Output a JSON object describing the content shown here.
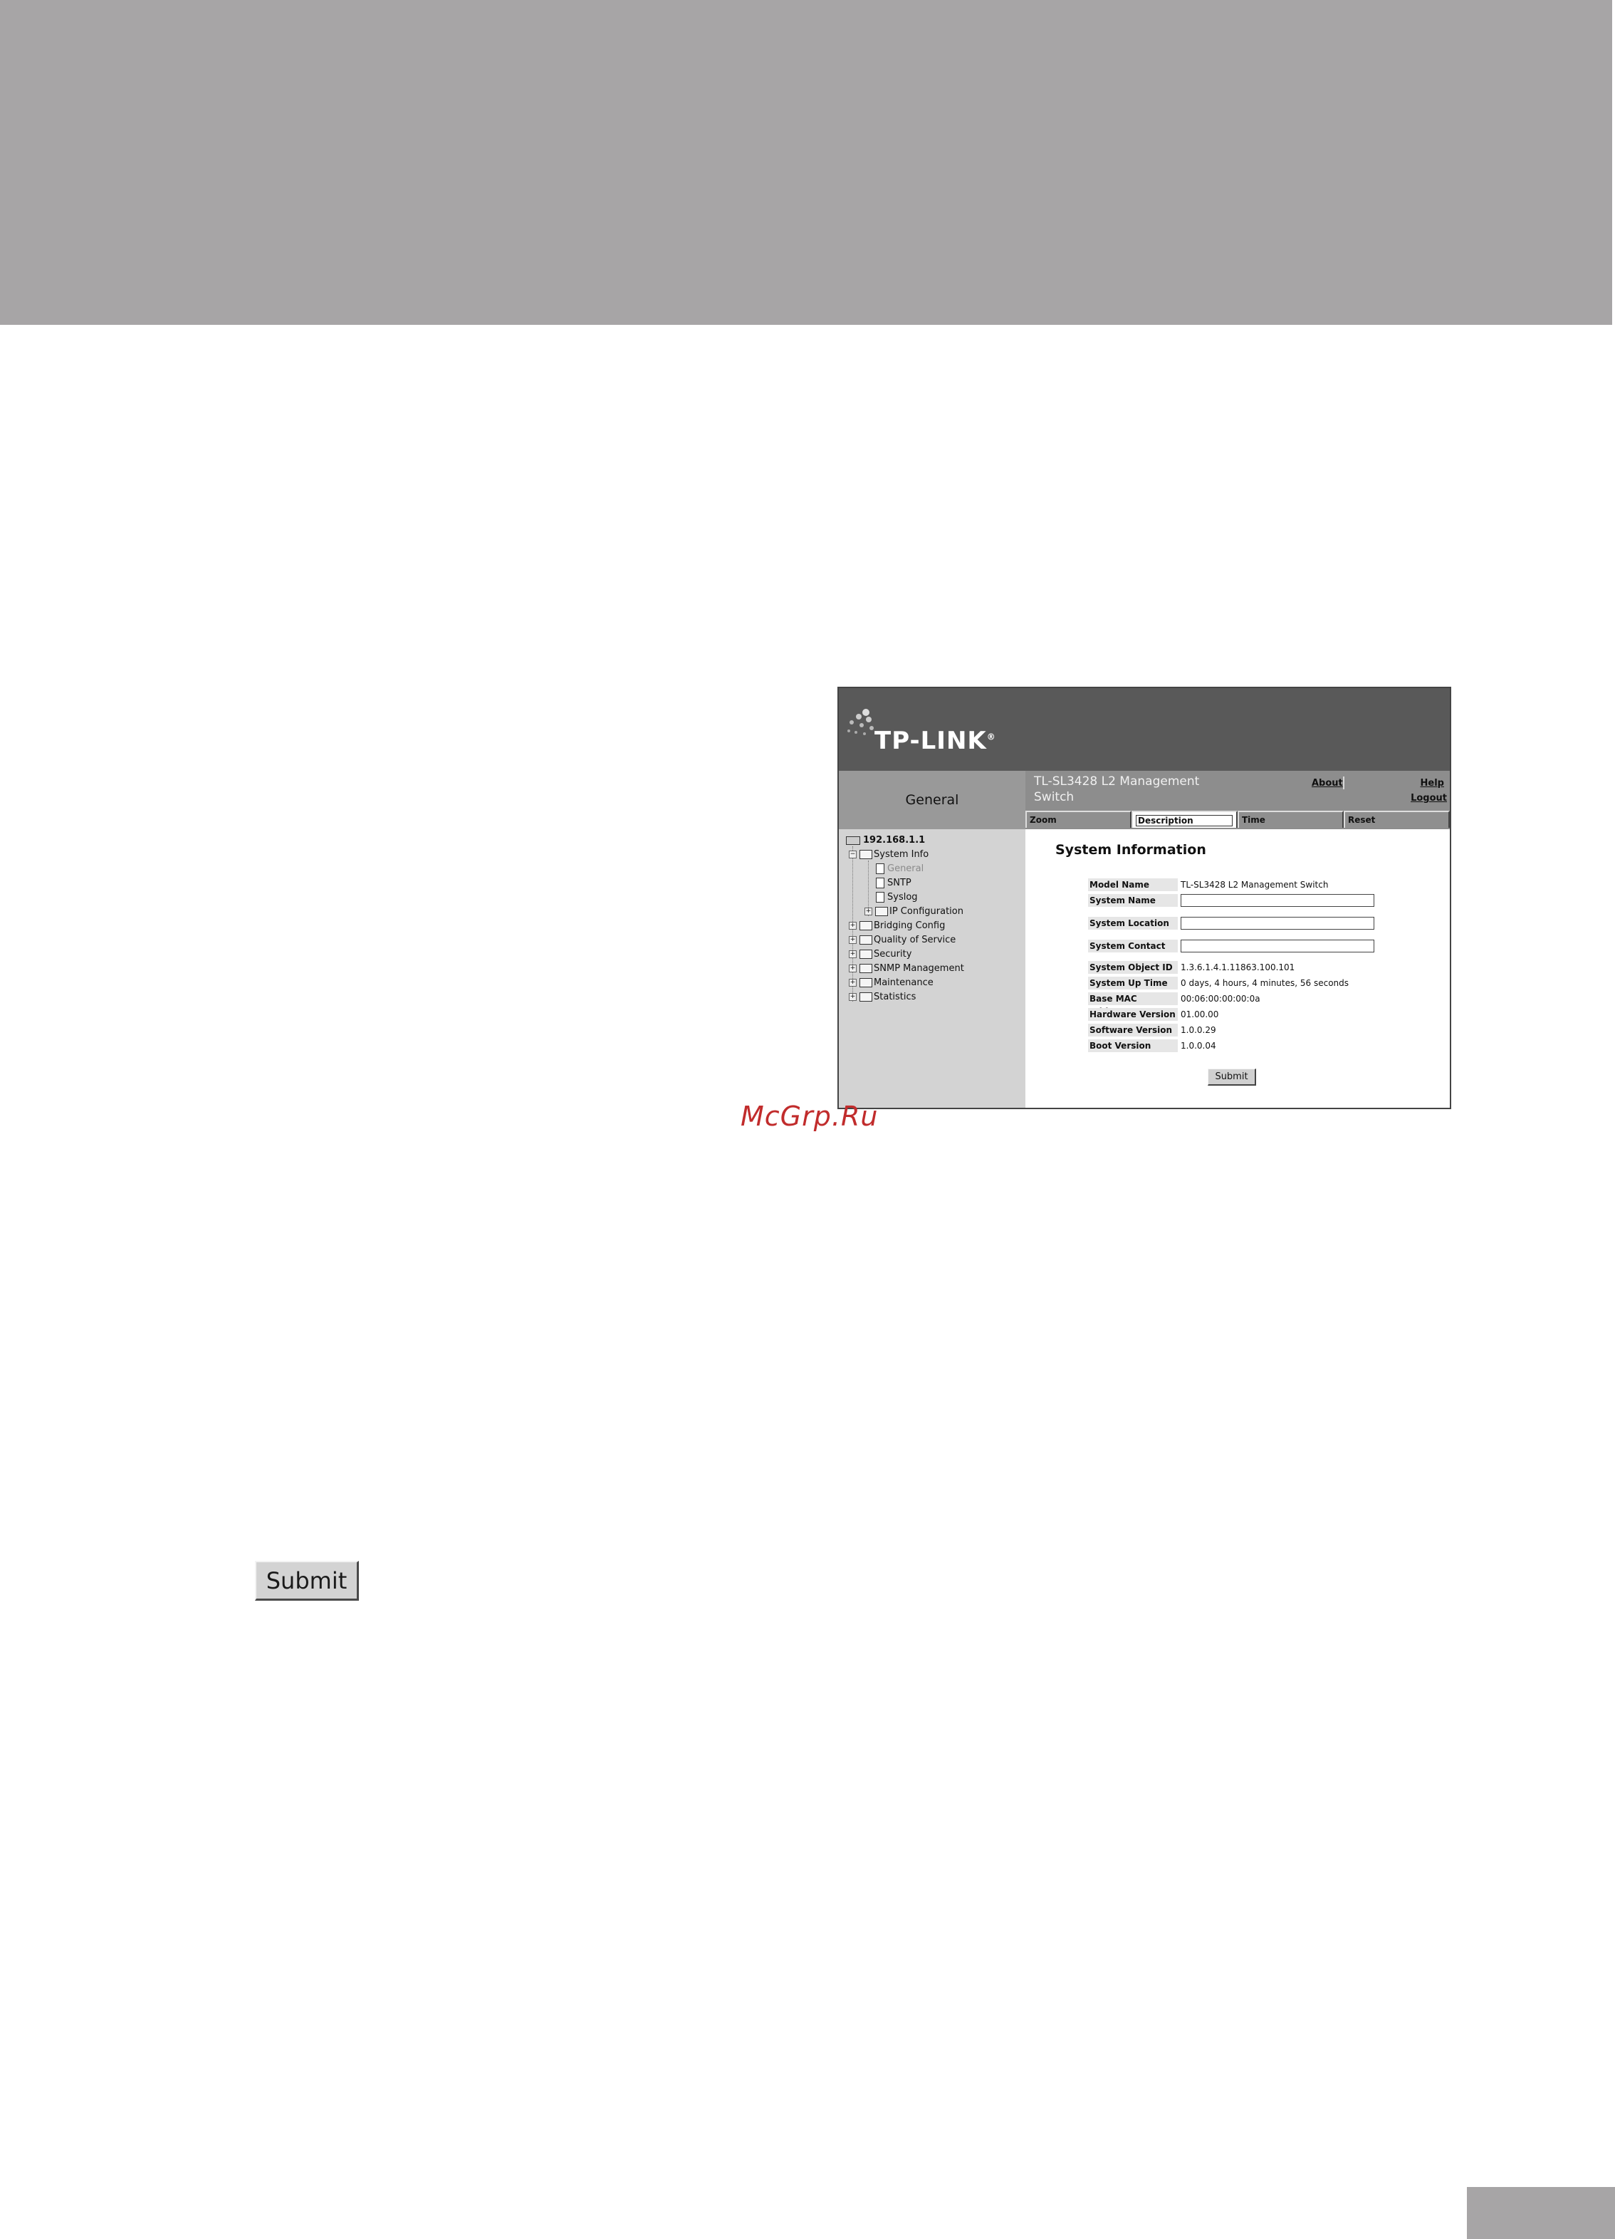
{
  "watermark": "McGrp.Ru",
  "document_button": "Submit",
  "app": {
    "logo": "TP-LINK",
    "section_title": "General",
    "device_name": "TL-SL3428 L2 Management Switch",
    "links": {
      "about": "About",
      "help": "Help",
      "logout": "Logout"
    },
    "tabs": [
      "Zoom",
      "Description",
      "Time",
      "Reset"
    ],
    "active_tab": "Description"
  },
  "tree": {
    "root": "192.168.1.1",
    "items": [
      {
        "label": "System Info",
        "type": "folder",
        "expanded": true
      },
      {
        "label": "General",
        "type": "page",
        "selected": true
      },
      {
        "label": "SNTP",
        "type": "page"
      },
      {
        "label": "Syslog",
        "type": "page"
      },
      {
        "label": "IP Configuration",
        "type": "folder"
      },
      {
        "label": "Bridging Config",
        "type": "folder"
      },
      {
        "label": "Quality of Service",
        "type": "folder"
      },
      {
        "label": "Security",
        "type": "folder"
      },
      {
        "label": "SNMP Management",
        "type": "folder"
      },
      {
        "label": "Maintenance",
        "type": "folder"
      },
      {
        "label": "Statistics",
        "type": "folder"
      }
    ]
  },
  "system_info": {
    "title": "System Information",
    "rows": [
      {
        "label": "Model Name",
        "value": "TL-SL3428 L2 Management Switch"
      },
      {
        "label": "System Name",
        "value": ""
      },
      {
        "label": "System Location",
        "value": ""
      },
      {
        "label": "System Contact",
        "value": ""
      },
      {
        "label": "System Object ID",
        "value": "1.3.6.1.4.1.11863.100.101"
      },
      {
        "label": "System Up Time",
        "value": "0 days, 4 hours, 4 minutes, 56 seconds"
      },
      {
        "label": "Base MAC Address",
        "value": "00:06:00:00:00:0a"
      },
      {
        "label": "Hardware Version",
        "value": "01.00.00"
      },
      {
        "label": "Software Version",
        "value": "1.0.0.29"
      },
      {
        "label": "Boot Version",
        "value": "1.0.0.04"
      }
    ],
    "submit_label": "Submit"
  }
}
